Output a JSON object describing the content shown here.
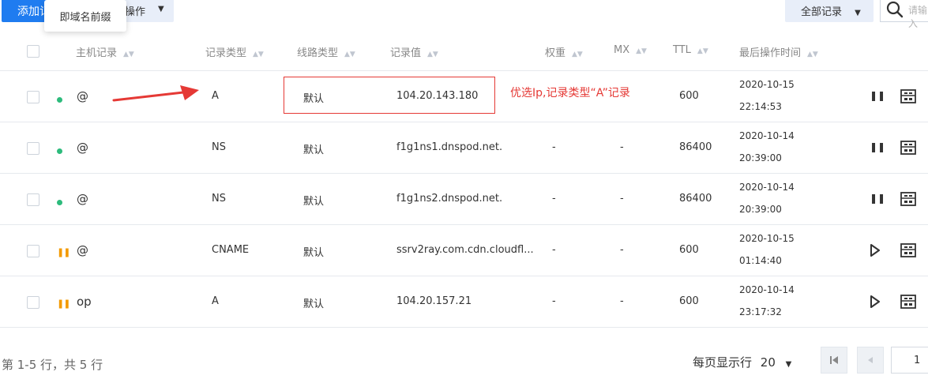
{
  "toolbar": {
    "add_label": "添加记录",
    "batch_label": "操作",
    "tooltip": "即域名前缀",
    "all_records_label": "全部记录",
    "search_placeholder": "请输入"
  },
  "table": {
    "headers": {
      "host": "主机记录",
      "type": "记录类型",
      "line": "线路类型",
      "value": "记录值",
      "weight": "权重",
      "mx": "MX",
      "ttl": "TTL",
      "time": "最后操作时间"
    },
    "rows": [
      {
        "status": "enabled",
        "host": "@",
        "type": "A",
        "line": "默认",
        "value": "104.20.143.180",
        "weight": "",
        "mx": "",
        "ttl": "600",
        "date": "2020-10-15",
        "time": "22:14:53",
        "action": "pause"
      },
      {
        "status": "enabled",
        "host": "@",
        "type": "NS",
        "line": "默认",
        "value": "f1g1ns1.dnspod.net.",
        "weight": "-",
        "mx": "-",
        "ttl": "86400",
        "date": "2020-10-14",
        "time": "20:39:00",
        "action": "pause"
      },
      {
        "status": "enabled",
        "host": "@",
        "type": "NS",
        "line": "默认",
        "value": "f1g1ns2.dnspod.net.",
        "weight": "-",
        "mx": "-",
        "ttl": "86400",
        "date": "2020-10-14",
        "time": "20:39:00",
        "action": "pause"
      },
      {
        "status": "paused",
        "host": "@",
        "type": "CNAME",
        "line": "默认",
        "value": "ssrv2ray.com.cdn.cloudfl...",
        "weight": "-",
        "mx": "-",
        "ttl": "600",
        "date": "2020-10-15",
        "time": "01:14:40",
        "action": "play"
      },
      {
        "status": "paused",
        "host": "op",
        "type": "A",
        "line": "默认",
        "value": "104.20.157.21",
        "weight": "-",
        "mx": "-",
        "ttl": "600",
        "date": "2020-10-14",
        "time": "23:17:32",
        "action": "play"
      }
    ]
  },
  "annotation": {
    "text": "优选Ip,记录类型“A”记录",
    "color": "#e53935"
  },
  "footer": {
    "info": "第 1-5 行，共 5 行",
    "per_page_label": "每页显示行",
    "per_page_value": "20",
    "page_input": "1"
  },
  "colors": {
    "primary": "#1f7cf0",
    "enabled": "#2dbb7c",
    "paused": "#f39a00"
  }
}
